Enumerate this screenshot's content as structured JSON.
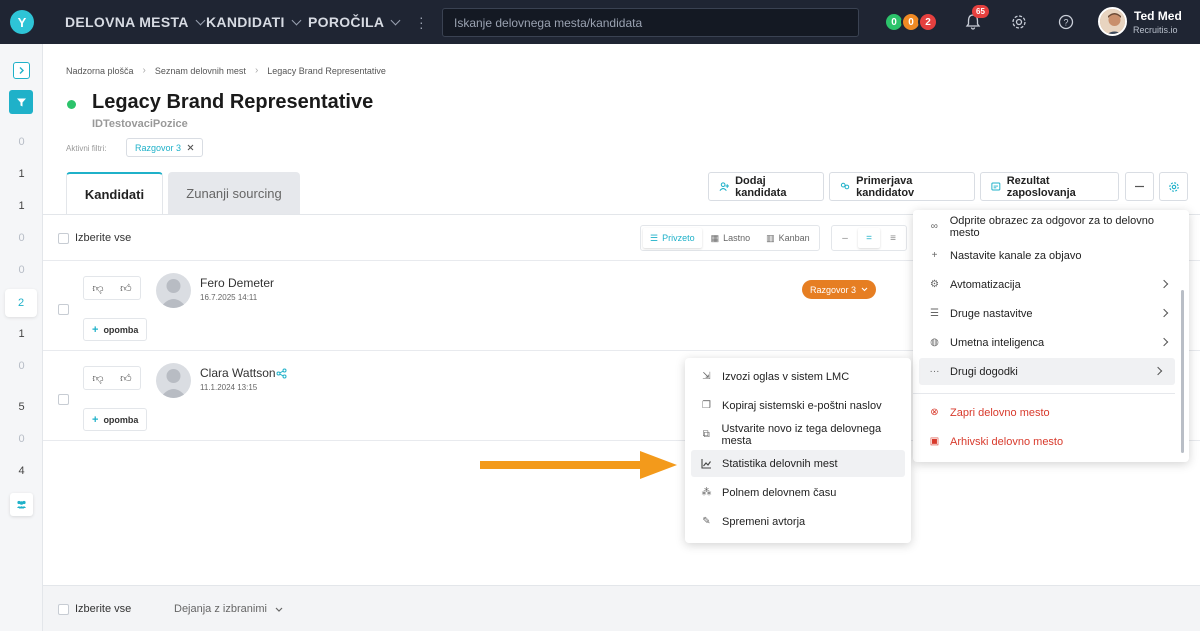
{
  "topbar": {
    "logo": "Y",
    "nav": [
      "DELOVNA MESTA",
      "KANDIDATI",
      "POROČILA"
    ],
    "search_placeholder": "Iskanje delovnega mesta/kandidata",
    "stats": [
      {
        "value": "0",
        "color": "#2cc36b"
      },
      {
        "value": "0",
        "color": "#f08a24"
      },
      {
        "value": "2",
        "color": "#e5403f"
      }
    ],
    "notifications": "65",
    "user": {
      "name": "Ted Med",
      "org": "Recruitis.io"
    }
  },
  "sidebar": {
    "counts": [
      "0",
      "1",
      "1",
      "0",
      "0",
      "2",
      "1",
      "0",
      "5",
      "0",
      "4"
    ],
    "active_index": 5
  },
  "breadcrumb": [
    "Nadzorna plošča",
    "Seznam delovnih mest",
    "Legacy Brand Representative"
  ],
  "job": {
    "title": "Legacy Brand Representative",
    "subtitle": "IDTestovaciPozice",
    "status_color": "#2cc36b"
  },
  "filters": {
    "label": "Aktivni filtri:",
    "chips": [
      "Razgovor 3"
    ]
  },
  "tabs": [
    "Kandidati",
    "Zunanji sourcing"
  ],
  "actions": {
    "add_candidate": "Dodaj kandidata",
    "compare": "Primerjava kandidatov",
    "result": "Rezultat zaposlovanja"
  },
  "list": {
    "select_all": "Izberite vse",
    "views": [
      "Privzeto",
      "Lastno",
      "Kanban"
    ],
    "active_view": "Privzeto",
    "note_label": "opomba",
    "candidates": [
      {
        "name": "Fero Demeter",
        "date": "16.7.2025 14:11",
        "stage": "Razgovor 3"
      },
      {
        "name": "Clara Wattson",
        "date": "11.1.2024 13:15",
        "stage": ""
      }
    ]
  },
  "footer": {
    "select_all": "Izberite vse",
    "bulk_actions": "Dejanja z izbranimi"
  },
  "settings_menu": [
    {
      "label": "Odprite obrazec za odgovor za to delovno mesto",
      "icon": "link-icon",
      "submenu": false
    },
    {
      "label": "Nastavite kanale za objavo",
      "icon": "plus-icon",
      "submenu": false
    },
    {
      "label": "Avtomatizacija",
      "icon": "automation-icon",
      "submenu": true
    },
    {
      "label": "Druge nastavitve",
      "icon": "sliders-icon",
      "submenu": true
    },
    {
      "label": "Umetna inteligenca",
      "icon": "brain-icon",
      "submenu": true
    },
    {
      "label": "Drugi dogodki",
      "icon": "more-icon",
      "submenu": true
    },
    {
      "label": "Zapri delovno mesto",
      "icon": "close-circle-icon",
      "danger": true
    },
    {
      "label": "Arhivski delovno mesto",
      "icon": "archive-icon",
      "danger": true
    }
  ],
  "submenu": [
    {
      "label": "Izvozi oglas v sistem LMC",
      "icon": "export-icon"
    },
    {
      "label": "Kopiraj sistemski e-poštni naslov",
      "icon": "copy-icon"
    },
    {
      "label": "Ustvarite novo iz tega delovnega mesta",
      "icon": "duplicate-icon"
    },
    {
      "label": "Statistika delovnih mest",
      "icon": "chart-icon"
    },
    {
      "label": "Polnem delovnem času",
      "icon": "team-icon"
    },
    {
      "label": "Spremeni avtorja",
      "icon": "user-edit-icon"
    }
  ],
  "colors": {
    "accent": "#1fb1c9",
    "topbar": "#1f2533",
    "arrow": "#f39a1b",
    "stage": "#e67e22"
  }
}
